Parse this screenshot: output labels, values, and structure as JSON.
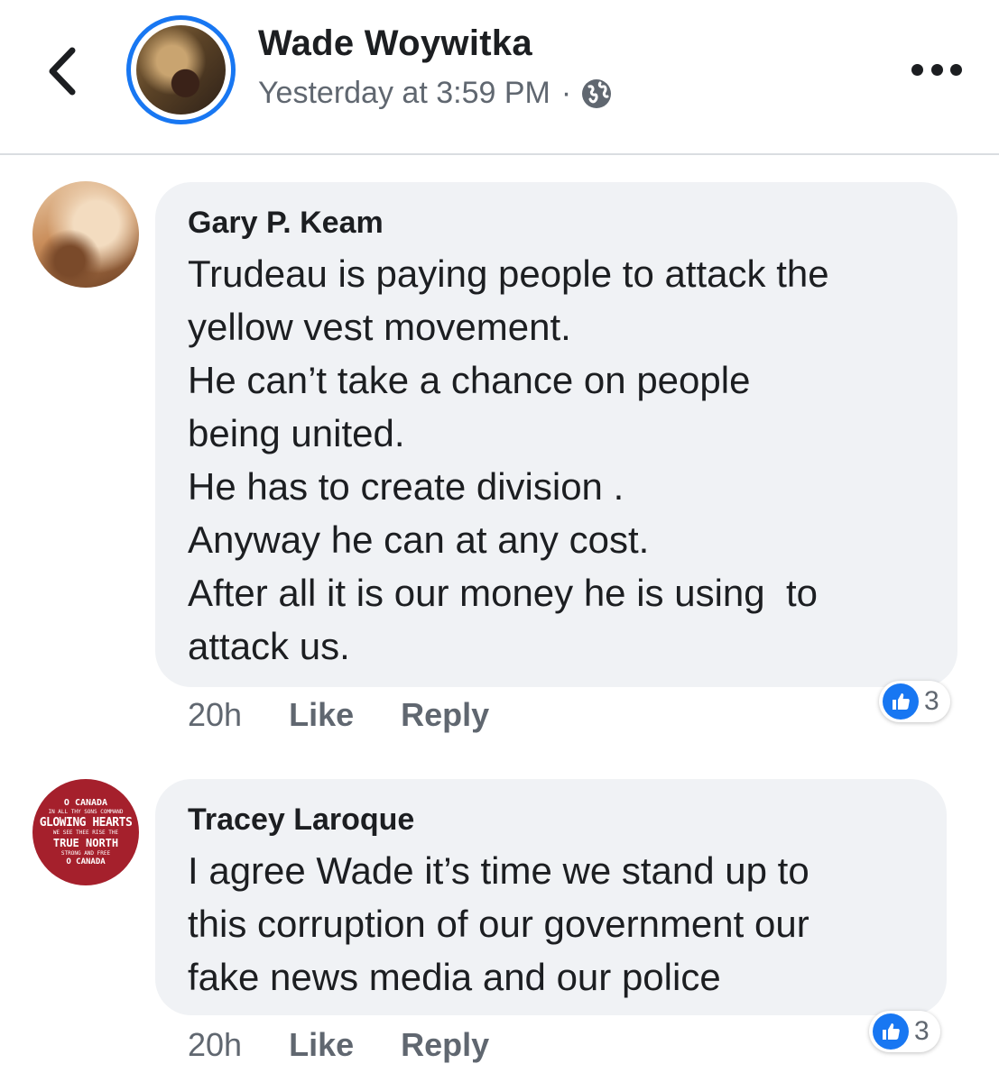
{
  "header": {
    "author": "Wade Woywitka",
    "timestamp": "Yesterday at 3:59 PM",
    "separator": "·",
    "privacy_icon": "globe-icon",
    "back_icon": "chevron-left-icon",
    "more_icon": "more-horizontal-icon"
  },
  "colors": {
    "accent": "#1877f2",
    "bubble": "#f0f2f5",
    "meta_text": "#606770",
    "primary_text": "#1c1e21"
  },
  "comments": [
    {
      "author": "Gary P. Keam",
      "lines": [
        "Trudeau is paying people to attack the",
        "yellow vest movement.",
        "He can’t take a chance on people",
        "being united.",
        "He has to create division .",
        "Anyway he can at any cost.",
        "After all it is our money he is using  to",
        "attack us."
      ],
      "time": "20h",
      "like_label": "Like",
      "reply_label": "Reply",
      "reaction_count": "3"
    },
    {
      "author": "Tracey Laroque",
      "avatar_text": {
        "l1": "O CANADA",
        "l2": "IN ALL THY SONS COMMAND",
        "l3": "GLOWING HEARTS",
        "l4": "WE SEE THEE RISE THE",
        "l5": "TRUE NORTH",
        "l6": "STRONG AND FREE",
        "l7": "O CANADA"
      },
      "lines": [
        "I agree Wade it’s time we stand up to",
        "this corruption of our government our",
        "fake news media and our police"
      ],
      "time": "20h",
      "like_label": "Like",
      "reply_label": "Reply",
      "reaction_count": "3"
    }
  ]
}
